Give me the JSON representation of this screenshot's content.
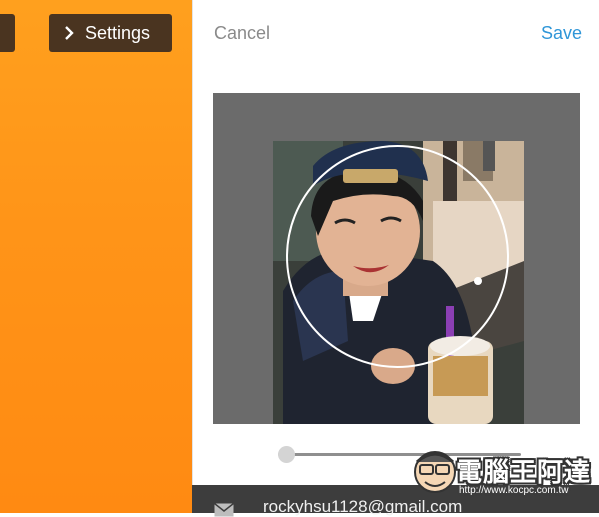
{
  "sidebar": {
    "settings_label": "Settings"
  },
  "header": {
    "cancel_label": "Cancel",
    "save_label": "Save"
  },
  "cropper": {
    "zoom_level": 0.0
  },
  "account": {
    "email": "rockyhsu1128@gmail.com"
  },
  "watermark": {
    "title": "電腦王阿達",
    "url": "http://www.kocpc.com.tw"
  },
  "colors": {
    "orange": "#ff9418",
    "dark_button": "#4a3420",
    "save_blue": "#2f96d8",
    "cancel_gray": "#8a8a8a",
    "crop_backdrop": "#6b6b6b"
  },
  "icons": {
    "settings_chevron": "chevron-right-icon",
    "email": "mail-icon",
    "watermark_mascot": "mascot-logo"
  }
}
